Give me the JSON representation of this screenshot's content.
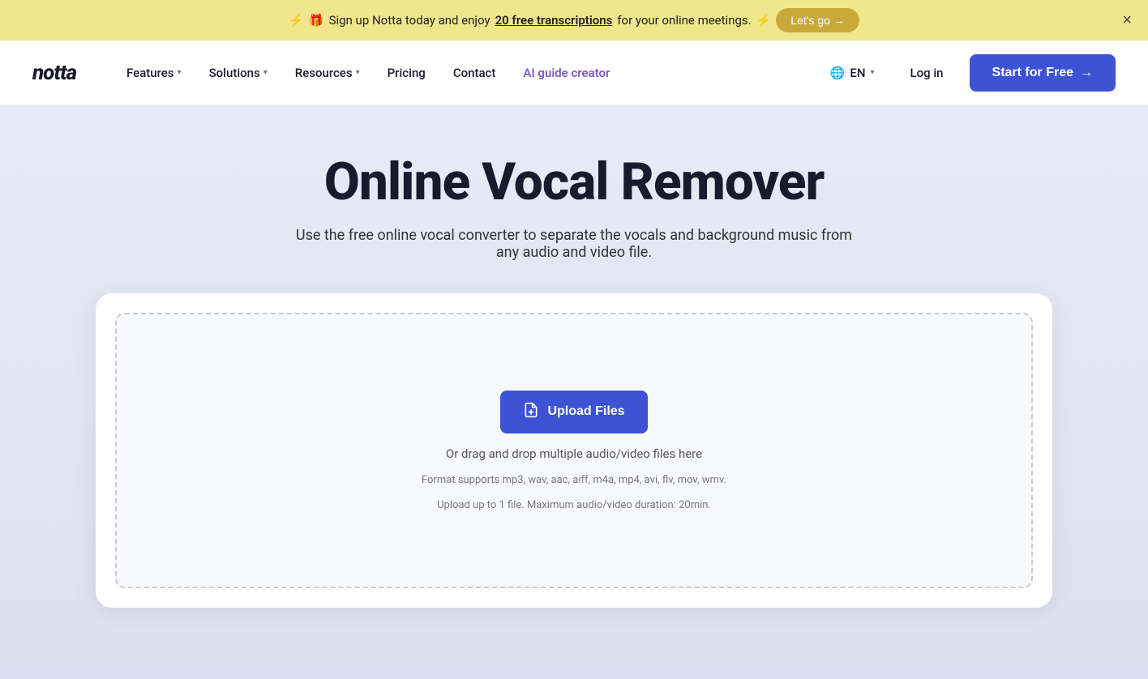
{
  "banner": {
    "icon_gift": "🎁",
    "icon_left": "⚡",
    "icon_right": "⚡",
    "text_prefix": "Sign up Notta today and enjoy",
    "text_link": "20 free transcriptions",
    "text_suffix": "for your online meetings.",
    "cta_label": "Let's go →",
    "close_label": "×"
  },
  "navbar": {
    "logo": "notta",
    "features_label": "Features",
    "solutions_label": "Solutions",
    "resources_label": "Resources",
    "pricing_label": "Pricing",
    "contact_label": "Contact",
    "ai_guide_label": "AI guide creator",
    "lang_label": "EN",
    "login_label": "Log in",
    "start_label": "Start for Free",
    "start_arrow": "→"
  },
  "hero": {
    "title": "Online Vocal Remover",
    "subtitle": "Use the free online vocal converter to separate the vocals and background music from any audio and video file."
  },
  "upload": {
    "btn_label": "Upload Files",
    "or_drag_text": "Or drag and drop multiple audio/video files here",
    "formats_text": "Format supports mp3, wav, aac, aiff, m4a, mp4, avi, flv, mov, wmv.",
    "limit_text": "Upload up to 1 file. Maximum audio/video duration: 20min."
  }
}
